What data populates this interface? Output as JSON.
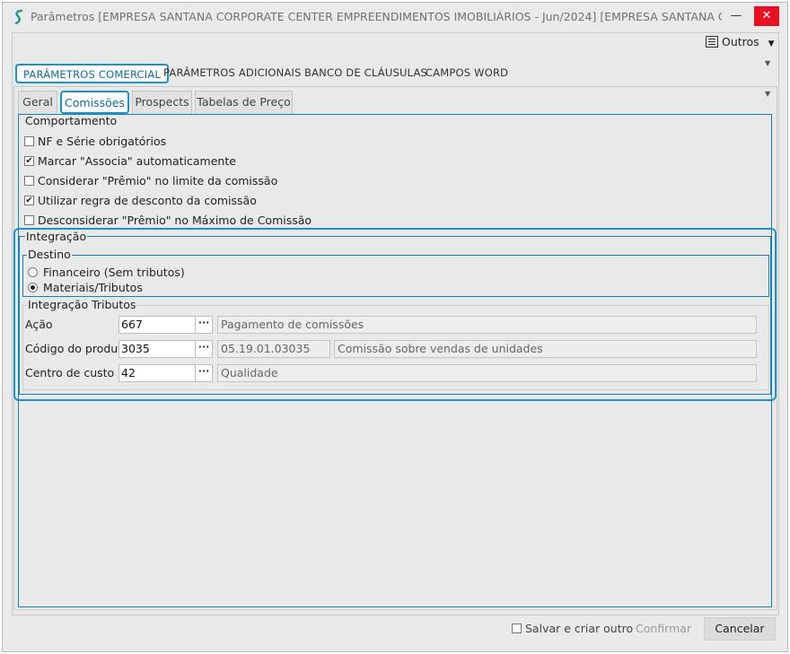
{
  "window": {
    "title": "Parâmetros [EMPRESA SANTANA CORPORATE CENTER EMPREENDIMENTOS IMOBILIÁRIOS - Jun/2024]  [EMPRESA SANTANA CO...",
    "minimize_label": "—",
    "maximize_label": "☐",
    "close_label": "✕"
  },
  "toolbar": {
    "outros_label": "Outros"
  },
  "top_tabs": [
    {
      "label": "PARÂMETROS COMERCIAL",
      "active": true
    },
    {
      "label": "PARÂMETROS ADICIONAIS",
      "active": false
    },
    {
      "label": "BANCO DE CLÁUSULAS",
      "active": false
    },
    {
      "label": "CAMPOS WORD",
      "active": false
    }
  ],
  "sub_tabs": [
    {
      "label": "Geral",
      "active": false
    },
    {
      "label": "Comissões",
      "active": true
    },
    {
      "label": "Prospects",
      "active": false
    },
    {
      "label": "Tabelas de Preço",
      "active": false
    }
  ],
  "comportamento": {
    "legend": "Comportamento",
    "options": [
      {
        "label": "NF e Série obrigatórios",
        "checked": false
      },
      {
        "label": "Marcar \"Associa\" automaticamente",
        "checked": true
      },
      {
        "label": "Considerar \"Prêmio\" no limite da comissão",
        "checked": false
      },
      {
        "label": "Utilizar regra de desconto da comissão",
        "checked": true
      },
      {
        "label": "Desconsiderar \"Prêmio\" no Máximo de Comissão",
        "checked": false
      }
    ]
  },
  "integracao": {
    "legend": "Integração",
    "destino": {
      "legend": "Destino",
      "options": [
        {
          "label": "Financeiro (Sem tributos)",
          "selected": false
        },
        {
          "label": "Materiais/Tributos",
          "selected": true
        }
      ]
    },
    "tributos": {
      "legend": "Integração Tributos",
      "lookup_label": "···",
      "acao": {
        "label": "Ação",
        "value": "667",
        "description": "Pagamento de comissões"
      },
      "produto": {
        "label": "Código do produto",
        "value": "3035",
        "code": "05.19.01.03035",
        "description": "Comissão sobre vendas de unidades"
      },
      "centro": {
        "label": "Centro de custo",
        "value": "42",
        "description": "Qualidade"
      }
    }
  },
  "footer": {
    "save_new_label": "Salvar e criar outro",
    "save_new_checked": false,
    "confirm_label": "Confirmar",
    "cancel_label": "Cancelar"
  },
  "colors": {
    "accent": "#1a93c9",
    "panel_border": "#1a7fb6",
    "close": "#e81123"
  }
}
